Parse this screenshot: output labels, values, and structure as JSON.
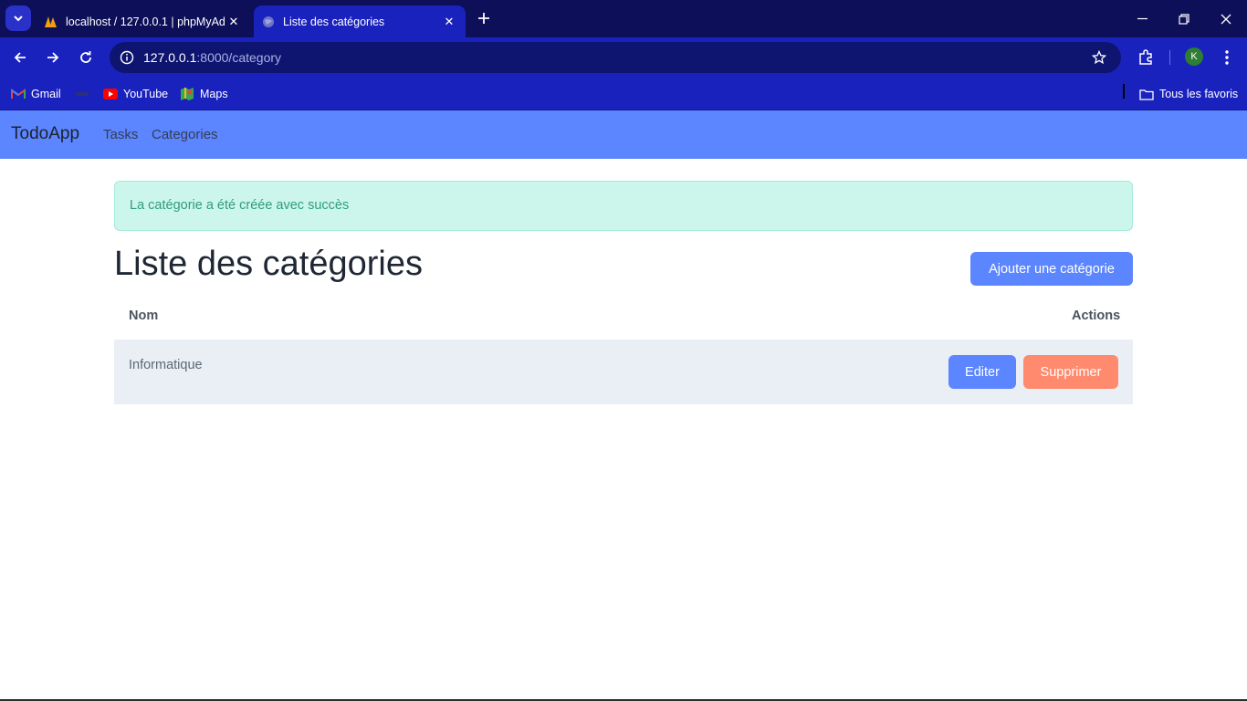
{
  "browser": {
    "tabs": [
      {
        "title": "localhost / 127.0.0.1 | phpMyAd",
        "active": false
      },
      {
        "title": "Liste des catégories",
        "active": true
      }
    ],
    "url_host": "127.0.0.1",
    "url_rest": ":8000/category",
    "profile_initial": "K",
    "bookmarks": [
      {
        "label": "Gmail",
        "icon": "gmail-icon"
      },
      {
        "label": "YouTube",
        "icon": "youtube-icon"
      },
      {
        "label": "Maps",
        "icon": "maps-icon"
      }
    ],
    "all_bookmarks_label": "Tous les favoris",
    "colors": {
      "tabstrip": "#0d0f58",
      "toolbar": "#1a22bd",
      "omnibox": "#0e1570"
    }
  },
  "app": {
    "brand": "TodoApp",
    "nav": [
      {
        "label": "Tasks"
      },
      {
        "label": "Categories"
      }
    ],
    "alert": "La catégorie a été créée avec succès",
    "page_title": "Liste des catégories",
    "add_button": "Ajouter une catégorie",
    "table": {
      "headers": [
        "Nom",
        "Actions"
      ],
      "rows": [
        {
          "name": "Informatique",
          "edit": "Editer",
          "delete": "Supprimer"
        }
      ]
    },
    "colors": {
      "primary": "#5c86ff",
      "danger": "#ff8a6d",
      "success_bg": "#ccf6ec",
      "success_text": "#2f9c7d"
    }
  }
}
